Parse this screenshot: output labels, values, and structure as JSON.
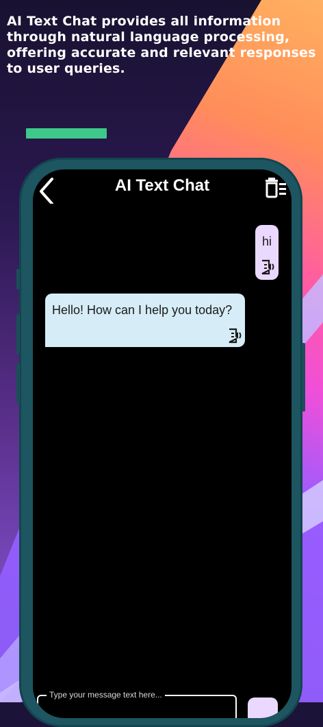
{
  "headline": "AI Text Chat provides all information through natural language processing, offering accurate and relevant responses to user queries.",
  "app": {
    "title": "AI Text Chat"
  },
  "messages": [
    {
      "role": "user",
      "text": "hi"
    },
    {
      "role": "assistant",
      "text": "Hello! How can I help you today?"
    }
  ],
  "input": {
    "placeholder": "Type your message text here..."
  },
  "icons": {
    "back": "back-chevron-icon",
    "clear": "trash-icon",
    "speak": "speaker-document-icon"
  },
  "colors": {
    "accent_bar": "#3ec98a",
    "phone_frame": "#1d5560",
    "user_bubble": "#ebd8ff",
    "bot_bubble": "#d6edf7"
  }
}
